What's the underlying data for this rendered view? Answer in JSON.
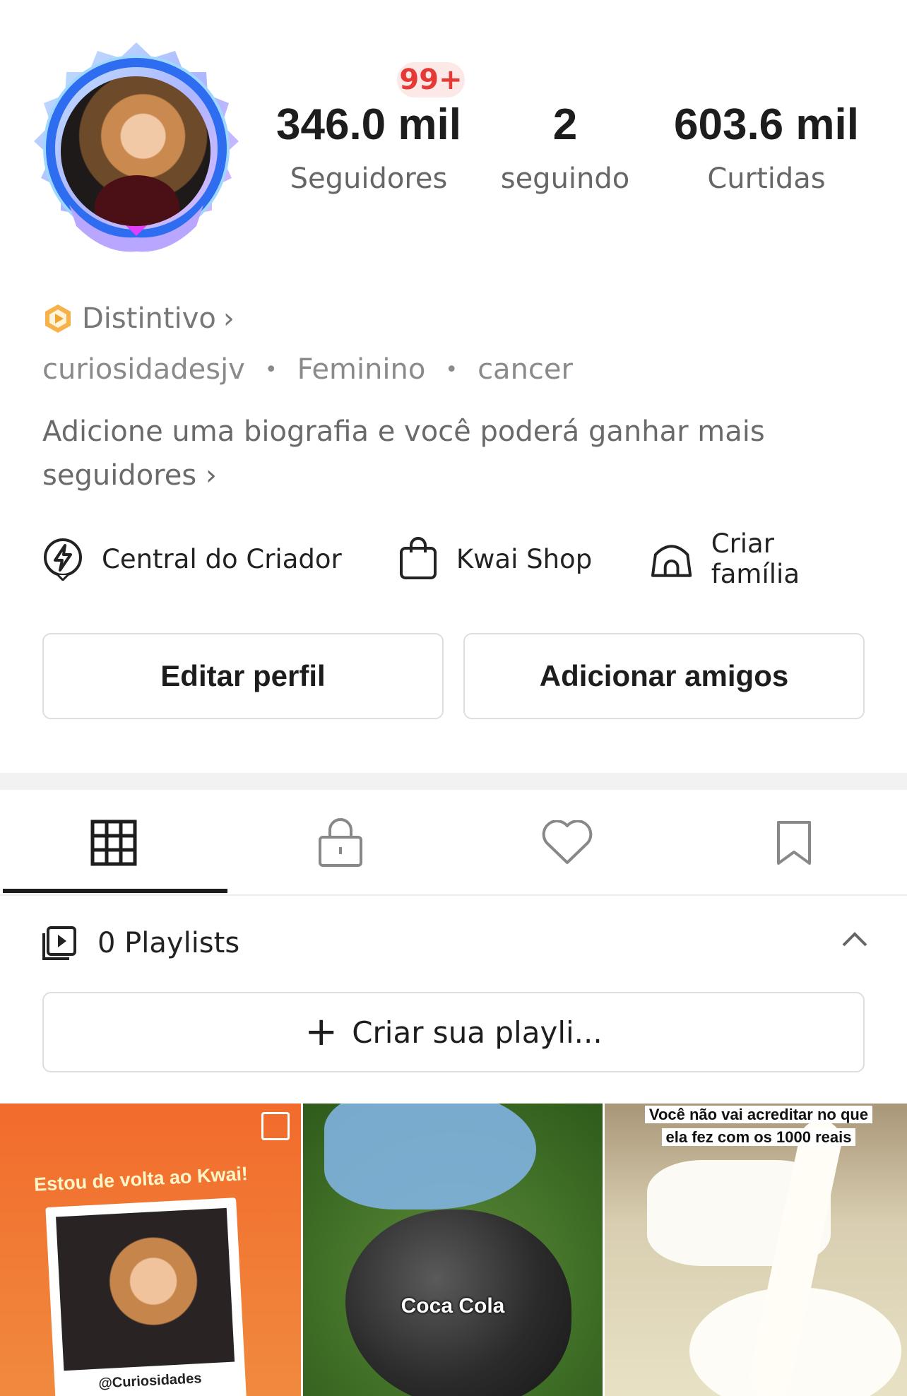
{
  "profile": {
    "notifications_badge": "99+",
    "stats": [
      {
        "value": "346.0 mil",
        "label": "Seguidores"
      },
      {
        "value": "2",
        "label": "seguindo"
      },
      {
        "value": "603.6 mil",
        "label": "Curtidas"
      }
    ],
    "badge_label": "Distintivo",
    "badge_chevron": "›",
    "username": "curiosidadesjv",
    "gender": "Feminino",
    "sign": "cancer",
    "meta_separator": "•",
    "bio_prompt": "Adicione uma biografia e você poderá ganhar mais seguidores",
    "bio_chevron": "›"
  },
  "quick_actions": [
    {
      "label": "Central do Criador",
      "icon": "lightning-icon"
    },
    {
      "label": "Kwai Shop",
      "icon": "shopping-bag-icon"
    },
    {
      "label": "Criar família",
      "icon": "house-icon"
    }
  ],
  "buttons": {
    "edit_profile": "Editar perfil",
    "add_friends": "Adicionar amigos"
  },
  "tabs": [
    {
      "icon": "grid-icon",
      "active": true
    },
    {
      "icon": "lock-icon",
      "active": false
    },
    {
      "icon": "heart-icon",
      "active": false
    },
    {
      "icon": "bookmark-icon",
      "active": false
    }
  ],
  "playlists": {
    "label": "0 Playlists",
    "create_label": "Criar sua playli...",
    "create_plus": "+"
  },
  "thumbnails": [
    {
      "title": "Estou de volta ao Kwai!",
      "handle": "@Curiosidades"
    },
    {
      "label": "Coca Cola"
    },
    {
      "caption_line1": "Você não vai acreditar no que",
      "caption_line2": "ela fez com os 1000 reais"
    }
  ],
  "colors": {
    "badge_red": "#e53935",
    "text_dark": "#1d1d1d",
    "text_gray": "#777777",
    "badge_gold": "#f0a530"
  }
}
